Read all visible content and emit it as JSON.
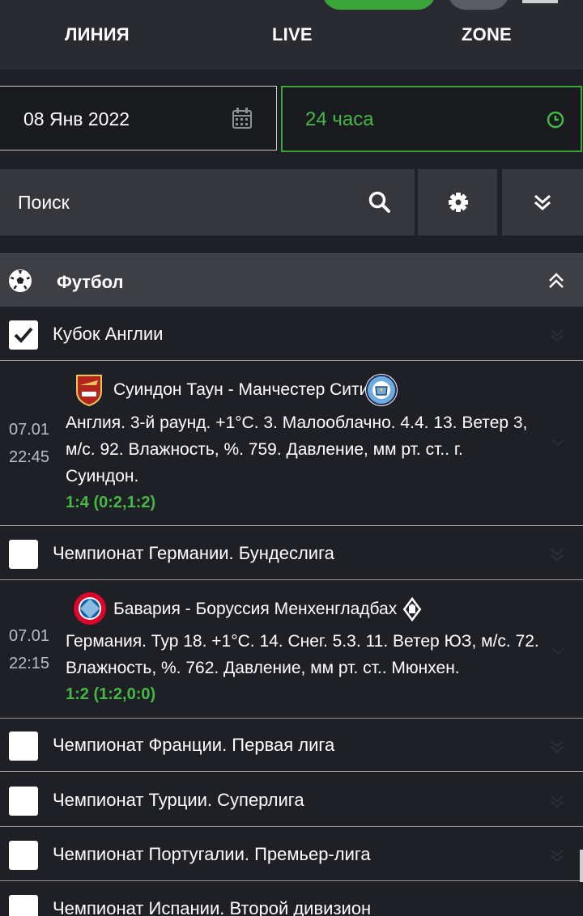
{
  "nav": {
    "tabs": [
      "ЛИНИЯ",
      "LIVE",
      "ZONE"
    ]
  },
  "filters": {
    "date": "08 Янв 2022",
    "period": "24 часа",
    "search_placeholder": "Поиск"
  },
  "sport": {
    "name": "Футбол"
  },
  "leagues": [
    {
      "name": "Кубок Англии",
      "checked": true,
      "match": {
        "date": "07.01",
        "time": "22:45",
        "teams": "Суиндон Таун - Манчестер Сити",
        "info_lines": [
          "Англия. 3-й раунд. +1°С. 3. Малооблачно. 4.4. 13. Ветер 3,",
          "м/с. 92. Влажность, %. 759. Давление, мм рт. ст.. г.",
          "Суиндон."
        ],
        "score": "1:4 (0:2,1:2)"
      }
    },
    {
      "name": "Чемпионат Германии. Бундеслига",
      "checked": false,
      "match": {
        "date": "07.01",
        "time": "22:15",
        "teams": "Бавария - Боруссия Менхенгладбах",
        "info_lines": [
          "Германия. Тур 18. +1°С. 14. Снег. 5.3. 11. Ветер ЮЗ, м/с. 72.",
          "Влажность, %. 762. Давление, мм рт. ст.. Мюнхен."
        ],
        "score": "1:2 (1:2,0:0)"
      }
    },
    {
      "name": "Чемпионат Франции. Первая лига",
      "checked": false
    },
    {
      "name": "Чемпионат Турции. Суперлига",
      "checked": false
    },
    {
      "name": "Чемпионат Португалии. Премьер-лига",
      "checked": false
    },
    {
      "name": "Чемпионат Испании. Второй дивизион",
      "checked": false
    }
  ],
  "colors": {
    "accent": "#45b845",
    "panel": "#36373c",
    "bg": "#1f2025"
  },
  "icons": [
    "calendar-icon",
    "clock-icon",
    "search-icon",
    "gear-icon",
    "chevrons-down-icon",
    "soccer-ball-icon",
    "chevrons-up-icon",
    "check-icon"
  ]
}
